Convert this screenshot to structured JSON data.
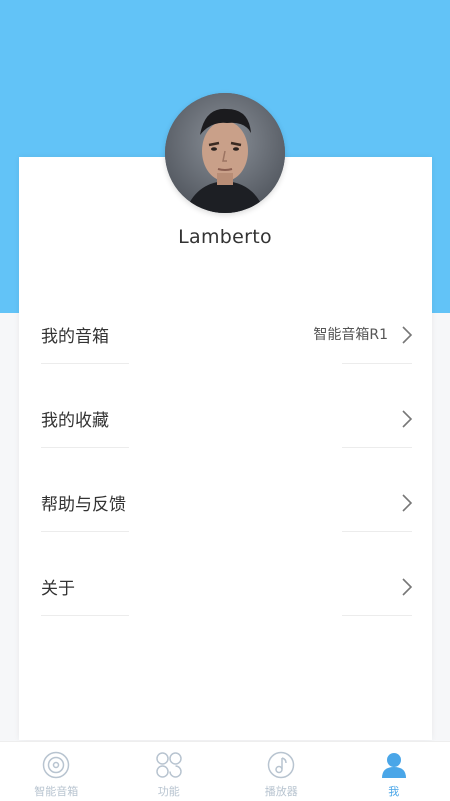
{
  "profile": {
    "username": "Lamberto"
  },
  "menu": {
    "items": [
      {
        "label": "我的音箱",
        "value": "智能音箱R1"
      },
      {
        "label": "我的收藏",
        "value": ""
      },
      {
        "label": "帮助与反馈",
        "value": ""
      },
      {
        "label": "关于",
        "value": ""
      }
    ]
  },
  "tabbar": {
    "tabs": [
      {
        "label": "智能音箱",
        "icon": "speaker-icon",
        "active": false
      },
      {
        "label": "功能",
        "icon": "grid-icon",
        "active": false
      },
      {
        "label": "播放器",
        "icon": "music-note-icon",
        "active": false
      },
      {
        "label": "我",
        "icon": "user-icon",
        "active": true
      }
    ]
  },
  "colors": {
    "header_bg": "#62c3f7",
    "active_tab": "#4aa6e8",
    "inactive_tab": "#b8c4d0"
  }
}
